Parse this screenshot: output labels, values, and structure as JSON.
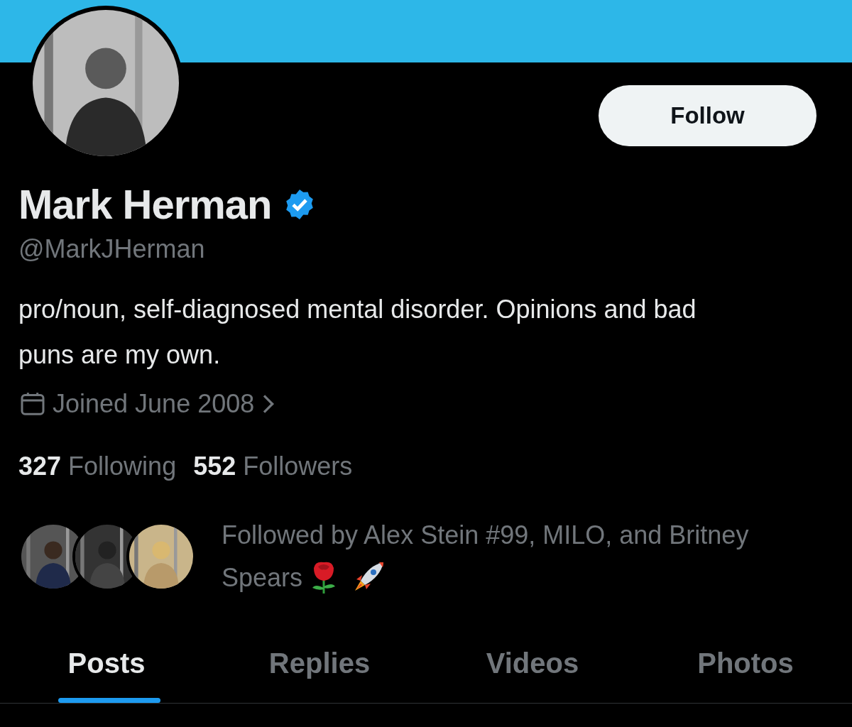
{
  "profile": {
    "name": "Mark Herman",
    "verified": true,
    "handle": "@MarkJHerman",
    "bio": "pro/noun, self-diagnosed mental disorder. Opinions and bad puns are my own.",
    "joined": "Joined June 2008"
  },
  "follow_button": {
    "label": "Follow"
  },
  "stats": [
    {
      "count": "327",
      "label": "Following"
    },
    {
      "count": "552",
      "label": "Followers"
    }
  ],
  "followed_by": {
    "text": "Followed by Alex Stein #99, MILO, and Britney Spears"
  },
  "tabs": [
    {
      "label": "Posts",
      "selected": true
    },
    {
      "label": "Replies",
      "selected": false
    },
    {
      "label": "Videos",
      "selected": false
    },
    {
      "label": "Photos",
      "selected": false
    }
  ]
}
